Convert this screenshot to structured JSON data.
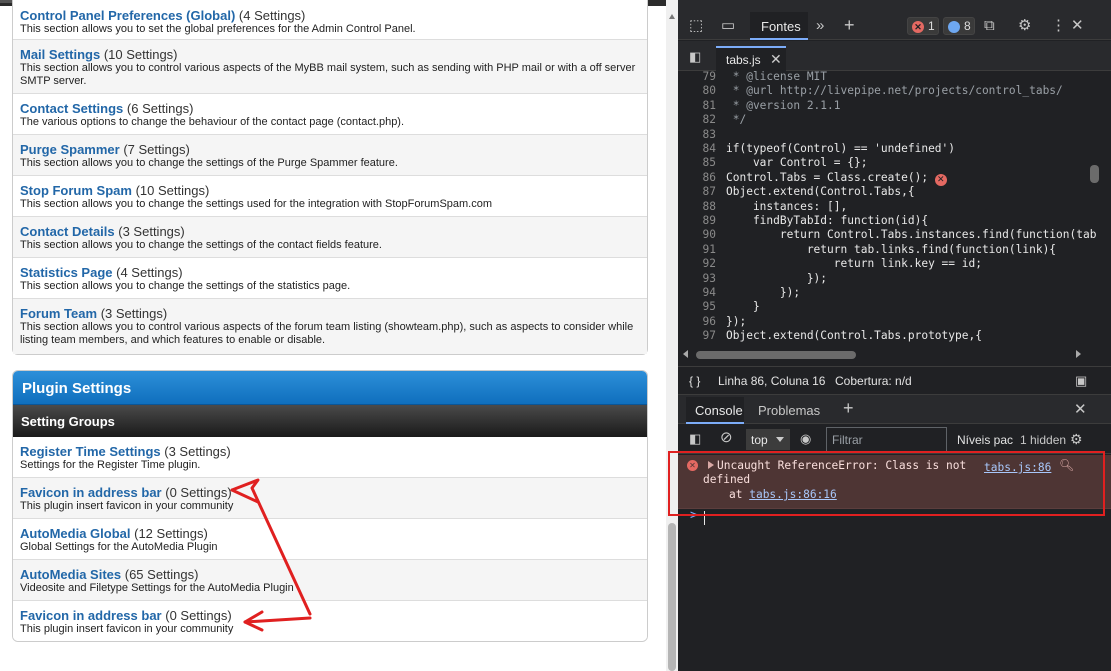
{
  "colors": {
    "link": "#2267a8",
    "panel_header": "#1574c4",
    "devtools_bg": "#202124",
    "error_bg": "#4e3534",
    "annotation": "#e02020",
    "accent": "#7cacf8"
  },
  "settings_groups": [
    {
      "title": "Control Panel Preferences (Global)",
      "count": "(4 Settings)",
      "desc": "This section allows you to set the global preferences for the Admin Control Panel."
    },
    {
      "title": "Mail Settings",
      "count": "(10 Settings)",
      "desc": "This section allows you to control various aspects of the MyBB mail system, such as sending with PHP mail or with a off server SMTP server."
    },
    {
      "title": "Contact Settings",
      "count": "(6 Settings)",
      "desc": "The various options to change the behaviour of the contact page (contact.php)."
    },
    {
      "title": "Purge Spammer",
      "count": "(7 Settings)",
      "desc": "This section allows you to change the settings of the Purge Spammer feature."
    },
    {
      "title": "Stop Forum Spam",
      "count": "(10 Settings)",
      "desc": "This section allows you to change the settings used for the integration with StopForumSpam.com"
    },
    {
      "title": "Contact Details",
      "count": "(3 Settings)",
      "desc": "This section allows you to change the settings of the contact fields feature."
    },
    {
      "title": "Statistics Page",
      "count": "(4 Settings)",
      "desc": "This section allows you to change the settings of the statistics page."
    },
    {
      "title": "Forum Team",
      "count": "(3 Settings)",
      "desc": "This section allows you to control various aspects of the forum team listing (showteam.php), such as aspects to consider while listing team members, and which features to enable or disable."
    }
  ],
  "plugin_panel": {
    "title": "Plugin Settings",
    "subheader": "Setting Groups",
    "groups": [
      {
        "title": "Register Time Settings",
        "count": "(3 Settings)",
        "desc": "Settings for the Register Time plugin."
      },
      {
        "title": "Favicon in address bar",
        "count": "(0 Settings)",
        "desc": "This plugin insert favicon in your community"
      },
      {
        "title": "AutoMedia Global",
        "count": "(12 Settings)",
        "desc": "Global Settings for the AutoMedia Plugin"
      },
      {
        "title": "AutoMedia Sites",
        "count": "(65 Settings)",
        "desc": "Videosite and Filetype Settings for the AutoMedia Plugin"
      },
      {
        "title": "Favicon in address bar",
        "count": "(0 Settings)",
        "desc": "This plugin insert favicon in your community"
      }
    ]
  },
  "devtools": {
    "toolbar": {
      "active_tab": "Fontes",
      "error_count": "1",
      "message_count": "8",
      "icons": [
        "inspect-icon",
        "device-toggle-icon",
        "more-tabs-icon",
        "add-tab-icon",
        "settings-icon",
        "kebab-menu-icon",
        "close-icon"
      ]
    },
    "file_tab": {
      "name": "tabs.js",
      "close": "✕"
    },
    "code_lines": [
      {
        "n": "79",
        "text": " * @license MIT"
      },
      {
        "n": "80",
        "text": " * @url http://livepipe.net/projects/control_tabs/"
      },
      {
        "n": "81",
        "text": " * @version 2.1.1"
      },
      {
        "n": "82",
        "text": " */"
      },
      {
        "n": "83",
        "text": ""
      },
      {
        "n": "84",
        "text": "if(typeof(Control) == 'undefined')"
      },
      {
        "n": "85",
        "text": "    var Control = {};"
      },
      {
        "n": "86",
        "text": "Control.Tabs = Class.create();"
      },
      {
        "n": "87",
        "text": "Object.extend(Control.Tabs,{"
      },
      {
        "n": "88",
        "text": "    instances: [],"
      },
      {
        "n": "89",
        "text": "    findByTabId: function(id){"
      },
      {
        "n": "90",
        "text": "        return Control.Tabs.instances.find(function(tab"
      },
      {
        "n": "91",
        "text": "            return tab.links.find(function(link){"
      },
      {
        "n": "92",
        "text": "                return link.key == id;"
      },
      {
        "n": "93",
        "text": "            });"
      },
      {
        "n": "94",
        "text": "        });"
      },
      {
        "n": "95",
        "text": "    }"
      },
      {
        "n": "96",
        "text": "});"
      },
      {
        "n": "97",
        "text": "Object.extend(Control.Tabs.prototype,{"
      }
    ],
    "status": {
      "braces": "{ }",
      "position": "Linha 86, Coluna 16",
      "coverage": "Cobertura: n/d"
    },
    "drawer_tabs": {
      "console": "Console",
      "problems": "Problemas"
    },
    "filter": {
      "context": "top",
      "placeholder": "Filtrar",
      "levels": "Níveis pac",
      "hidden": "1 hidden"
    },
    "error": {
      "line1": "Uncaught ReferenceError: Class is not",
      "line2": "defined",
      "at": "at ",
      "at_link": "tabs.js:86:16",
      "source": "tabs.js:86"
    },
    "prompt": ">"
  }
}
